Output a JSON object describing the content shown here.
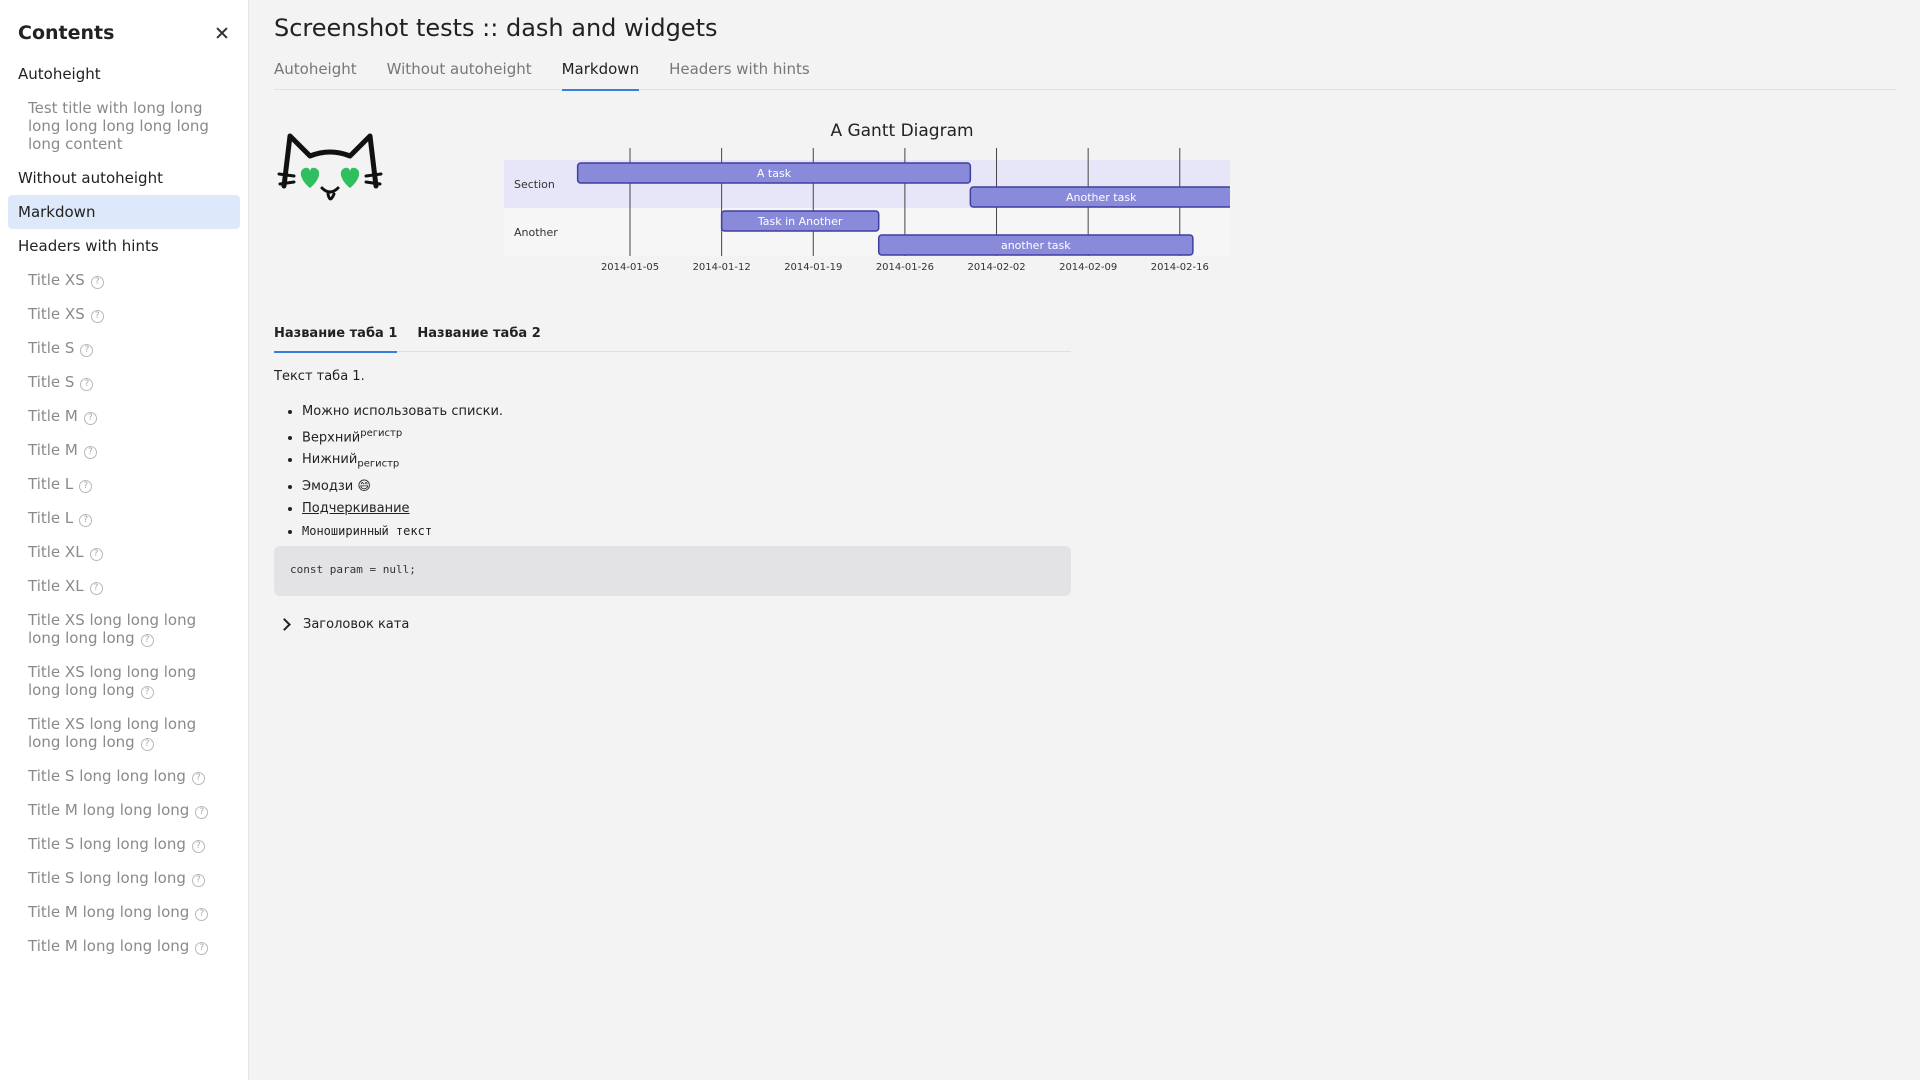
{
  "sidebar": {
    "title": "Contents",
    "items": [
      {
        "label": "Autoheight",
        "level": 0
      },
      {
        "label": "Test title with long long long long long long long long content",
        "level": 1
      },
      {
        "label": "Without autoheight",
        "level": 0
      },
      {
        "label": "Markdown",
        "level": 0,
        "active": true
      },
      {
        "label": "Headers with hints",
        "level": 0
      },
      {
        "label": "Title XS",
        "level": 1,
        "hint": true
      },
      {
        "label": "Title XS",
        "level": 1,
        "hint": true
      },
      {
        "label": "Title S",
        "level": 1,
        "hint": true
      },
      {
        "label": "Title S",
        "level": 1,
        "hint": true
      },
      {
        "label": "Title M",
        "level": 1,
        "hint": true
      },
      {
        "label": "Title M",
        "level": 1,
        "hint": true
      },
      {
        "label": "Title L",
        "level": 1,
        "hint": true
      },
      {
        "label": "Title L",
        "level": 1,
        "hint": true
      },
      {
        "label": "Title XL",
        "level": 1,
        "hint": true
      },
      {
        "label": "Title XL",
        "level": 1,
        "hint": true
      },
      {
        "label": "Title XS long long long long long long",
        "level": 1,
        "hint": true
      },
      {
        "label": "Title XS long long long long long long",
        "level": 1,
        "hint": true
      },
      {
        "label": "Title XS long long long long long long",
        "level": 1,
        "hint": true
      },
      {
        "label": "Title S long long long",
        "level": 1,
        "hint": true
      },
      {
        "label": "Title M long long long",
        "level": 1,
        "hint": true
      },
      {
        "label": "Title S long long long",
        "level": 1,
        "hint": true
      },
      {
        "label": "Title S long long long",
        "level": 1,
        "hint": true
      },
      {
        "label": "Title M long long long",
        "level": 1,
        "hint": true
      },
      {
        "label": "Title M long long long",
        "level": 1,
        "hint": true
      }
    ],
    "hint_glyph": "?"
  },
  "page": {
    "title": "Screenshot tests :: dash and widgets",
    "tabs": [
      {
        "label": "Autoheight"
      },
      {
        "label": "Without autoheight"
      },
      {
        "label": "Markdown",
        "active": true
      },
      {
        "label": "Headers with hints"
      }
    ]
  },
  "gantt": {
    "title": "A Gantt Diagram",
    "sections": [
      "Section",
      "Another"
    ],
    "ticks": [
      "2014-01-05",
      "2014-01-12",
      "2014-01-19",
      "2014-01-26",
      "2014-02-02",
      "2014-02-09",
      "2014-02-16"
    ],
    "tasks": [
      {
        "label": "A task",
        "section": 0,
        "start": "2014-01-01",
        "end": "2014-01-31"
      },
      {
        "label": "Another task",
        "section": 0,
        "start": "2014-01-31",
        "end": "2014-02-20"
      },
      {
        "label": "Task in Another",
        "section": 1,
        "start": "2014-01-12",
        "end": "2014-01-24"
      },
      {
        "label": "another task",
        "section": 1,
        "start": "2014-01-24",
        "end": "2014-02-17"
      }
    ],
    "colors": {
      "bar": "#8a8adb",
      "bar_border": "#3f3fa0",
      "band_a": "#e6e6f8",
      "band_b": "#f6f6f6"
    }
  },
  "markdown": {
    "tabs": [
      {
        "label": "Название таба 1",
        "active": true
      },
      {
        "label": "Название таба 2"
      }
    ],
    "paragraph": "Текст таба 1.",
    "list": {
      "item1": "Можно использовать списки.",
      "item2_base": "Верхний",
      "item2_sup": "регистр",
      "item3_base": "Нижний",
      "item3_sub": "регистр",
      "item4": "Эмодзи 😄",
      "item5": "Подчеркивание",
      "item6": "Моноширинный текст"
    },
    "code": "const param = null;",
    "cut_title": "Заголовок ката"
  }
}
